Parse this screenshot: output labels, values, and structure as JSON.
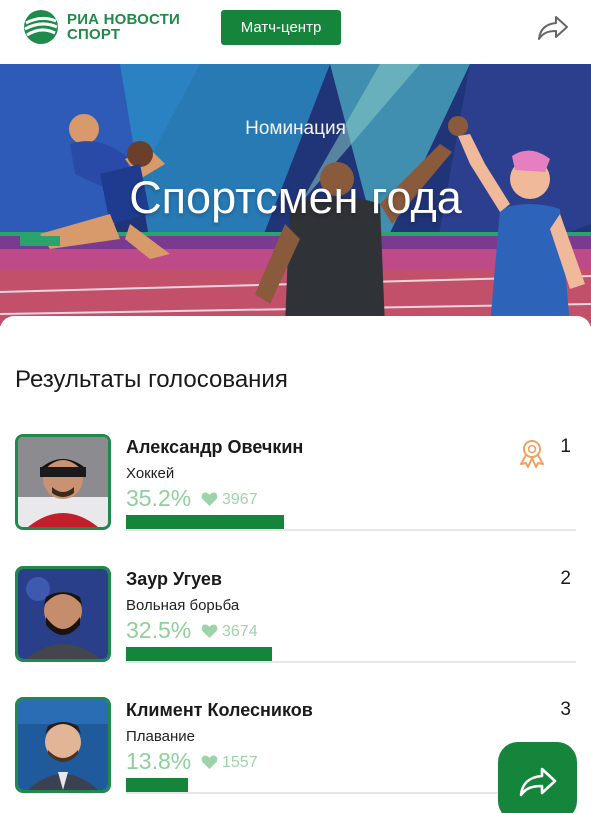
{
  "header": {
    "logo_line1": "РИА НОВОСТИ",
    "logo_line2": "СПОРТ",
    "match_center_label": "Матч-центр",
    "brand_color": "#14853b"
  },
  "banner": {
    "kicker": "Номинация",
    "title": "Спортсмен года"
  },
  "results": {
    "title": "Результаты голосования",
    "items": [
      {
        "rank": "1",
        "name": "Александр Овечкин",
        "sport": "Хоккей",
        "percent_label": "35.2%",
        "likes": "3967",
        "percent": 35.2,
        "award_icon": "medal-icon"
      },
      {
        "rank": "2",
        "name": "Заур Угуев",
        "sport": "Вольная борьба",
        "percent_label": "32.5%",
        "likes": "3674",
        "percent": 32.5
      },
      {
        "rank": "3",
        "name": "Климент Колесников",
        "sport": "Плавание",
        "percent_label": "13.8%",
        "likes": "1557",
        "percent": 13.8
      }
    ]
  },
  "icons": {
    "share_top": "share-arrow-icon",
    "like": "heart-icon",
    "fab": "share-arrow-icon"
  }
}
